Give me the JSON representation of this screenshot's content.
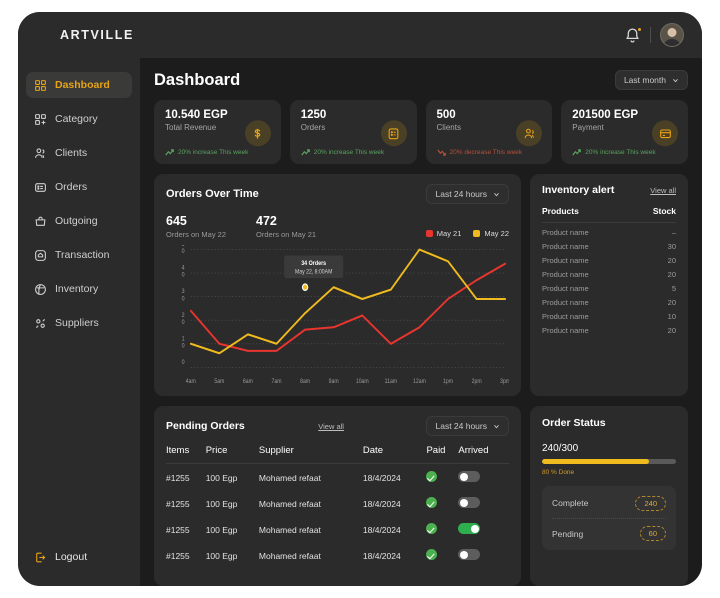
{
  "app": {
    "brand": "ARTVILLE",
    "page_title": "Dashboard",
    "range_filter": "Last month"
  },
  "topbar": {
    "bell_icon": "bell-icon",
    "avatar_icon": "user-avatar"
  },
  "sidebar": {
    "items": [
      {
        "label": "Dashboard",
        "icon": "grid-icon",
        "active": true
      },
      {
        "label": "Category",
        "icon": "category-icon",
        "active": false
      },
      {
        "label": "Clients",
        "icon": "users-icon",
        "active": false
      },
      {
        "label": "Orders",
        "icon": "clipboard-icon",
        "active": false
      },
      {
        "label": "Outgoing",
        "icon": "bag-icon",
        "active": false
      },
      {
        "label": "Transaction",
        "icon": "transaction-icon",
        "active": false
      },
      {
        "label": "Inventory",
        "icon": "inventory-icon",
        "active": false
      },
      {
        "label": "Suppliers",
        "icon": "suppliers-icon",
        "active": false
      }
    ],
    "logout": {
      "label": "Logout",
      "icon": "logout-icon"
    }
  },
  "kpis": [
    {
      "value": "10.540 EGP",
      "label": "Total Revenue",
      "trend": "20% increase This week",
      "direction": "up",
      "icon": "dollar-icon"
    },
    {
      "value": "1250",
      "label": "Orders",
      "trend": "20% increase This week",
      "direction": "up",
      "icon": "orders-icon"
    },
    {
      "value": "500",
      "label": "Clients",
      "trend": "20% decrease This week",
      "direction": "down",
      "icon": "clients-icon"
    },
    {
      "value": "201500 EGP",
      "label": "Payment",
      "trend": "20% increase This week",
      "direction": "up",
      "icon": "card-icon"
    }
  ],
  "orders_chart": {
    "title": "Orders Over Time",
    "range_filter": "Last 24 hours",
    "stats": [
      {
        "number": "645",
        "label": "Orders on May 22"
      },
      {
        "number": "472",
        "label": "Orders on May 21"
      }
    ],
    "legend": [
      {
        "label": "May 21",
        "color": "#e8352e"
      },
      {
        "label": "May 22",
        "color": "#f0bb1e"
      }
    ],
    "tooltip": {
      "line1": "34 Orders",
      "line2": "May 22, 8:00AM"
    }
  },
  "chart_data": {
    "type": "line",
    "title": "Orders Over Time",
    "xlabel": "",
    "ylabel": "",
    "grid": true,
    "legend_position": "top-right",
    "categories": [
      "4am",
      "5am",
      "6am",
      "7am",
      "8am",
      "9am",
      "10am",
      "11am",
      "12am",
      "1pm",
      "2pm",
      "3pm"
    ],
    "ylim": [
      0,
      50
    ],
    "yticks": [
      0,
      10,
      20,
      30,
      40,
      50
    ],
    "series": [
      {
        "name": "May 21",
        "color": "#e8352e",
        "values": [
          24,
          10,
          7,
          7,
          16,
          17,
          22,
          10,
          17,
          29,
          37,
          44
        ]
      },
      {
        "name": "May 22",
        "color": "#f0bb1e",
        "values": [
          10,
          6,
          14,
          10,
          23,
          34,
          29,
          33,
          50,
          45,
          29,
          29
        ]
      }
    ],
    "annotation": {
      "x": "8am",
      "y": 34,
      "text": "34 Orders May 22, 8:00AM"
    }
  },
  "inventory": {
    "title": "Inventory alert",
    "view_all": "View all",
    "columns": [
      "Products",
      "Stock"
    ],
    "rows": [
      {
        "product": "Product name",
        "stock": "–"
      },
      {
        "product": "Product name",
        "stock": "30"
      },
      {
        "product": "Product name",
        "stock": "20"
      },
      {
        "product": "Product name",
        "stock": "20"
      },
      {
        "product": "Product name",
        "stock": "5"
      },
      {
        "product": "Product name",
        "stock": "20"
      },
      {
        "product": "Product name",
        "stock": "10"
      },
      {
        "product": "Product name",
        "stock": "20"
      }
    ]
  },
  "pending_orders": {
    "title": "Pending Orders",
    "view_all": "View all",
    "range_filter": "Last 24 hours",
    "columns": [
      "Items",
      "Price",
      "Supplier",
      "Date",
      "Paid",
      "Arrived"
    ],
    "rows": [
      {
        "item": "#1255",
        "price": "100 Egp",
        "supplier": "Mohamed refaat",
        "date": "18/4/2024",
        "paid": true,
        "arrived": false
      },
      {
        "item": "#1255",
        "price": "100 Egp",
        "supplier": "Mohamed refaat",
        "date": "18/4/2024",
        "paid": true,
        "arrived": false
      },
      {
        "item": "#1255",
        "price": "100 Egp",
        "supplier": "Mohamed refaat",
        "date": "18/4/2024",
        "paid": true,
        "arrived": true
      },
      {
        "item": "#1255",
        "price": "100 Egp",
        "supplier": "Mohamed refaat",
        "date": "18/4/2024",
        "paid": true,
        "arrived": false
      }
    ]
  },
  "order_status": {
    "title": "Order Status",
    "count": "240/300",
    "percent": 80,
    "done_label": "80 % Done",
    "lines": [
      {
        "label": "Complete",
        "value": "240"
      },
      {
        "label": "Pending",
        "value": "60"
      }
    ]
  },
  "colors": {
    "accent": "#e8a317",
    "yellow": "#f0bb1e",
    "red": "#e8352e",
    "green": "#4caf50",
    "panel": "#2b2b2b",
    "canvas": "#1c1c1c"
  }
}
